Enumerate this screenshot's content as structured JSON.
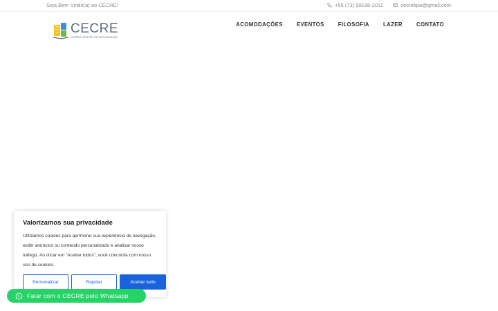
{
  "topbar": {
    "welcome": "Seja Bem Vindo(a) ao CECRE!",
    "phone": "+55 (73) 99198-2012",
    "email": "cecrebpa@gmail.com",
    "phone_icon": "phone-icon",
    "email_icon": "envelope-icon"
  },
  "logo": {
    "word": "CECRE",
    "subtitle": "CENTRO CRISTÃO DE RESTAURAÇÃO"
  },
  "nav": {
    "items": [
      "ACOMODAÇÕES",
      "EVENTOS",
      "FILOSOFIA",
      "LAZER",
      "CONTATO"
    ]
  },
  "cookie": {
    "title": "Valorizamos sua privacidade",
    "text": "Utilizamos cookies para aprimorar sua experiência de navegação, exibir anúncios ou conteúdo personalizado e analisar nosso tráfego. Ao clicar em \"Aceitar todos\", você concorda com nosso uso de cookies.",
    "customize_label": "Personalizar",
    "reject_label": "Rejeitar",
    "accept_label": "Aceitar tudo",
    "accent_color": "#1863dc"
  },
  "whatsapp": {
    "label": "Falar com o CECRE pelo Whatsapp",
    "icon": "whatsapp-icon",
    "color": "#25d366"
  }
}
